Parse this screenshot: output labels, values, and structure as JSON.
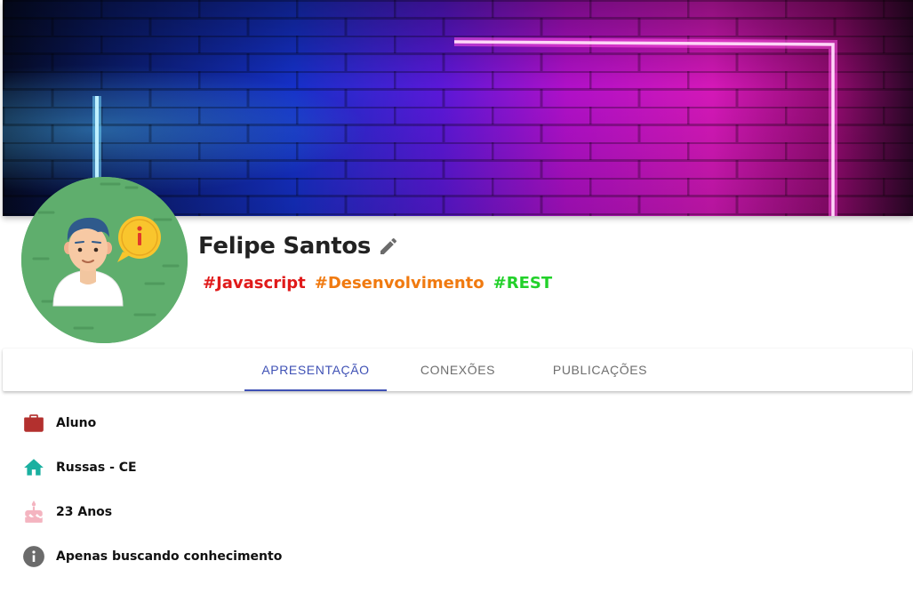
{
  "profile": {
    "name": "Felipe Santos"
  },
  "tags": [
    {
      "label": "#Javascript",
      "color": "#e01a1a"
    },
    {
      "label": "#Desenvolvimento",
      "color": "#f07a10"
    },
    {
      "label": "#REST",
      "color": "#22d12a"
    }
  ],
  "tabs": [
    {
      "label": "APRESENTAÇÃO",
      "active": true
    },
    {
      "label": "CONEXÕES",
      "active": false
    },
    {
      "label": "PUBLICAÇÕES",
      "active": false
    }
  ],
  "info": [
    {
      "icon": "briefcase-icon",
      "text": "Aluno",
      "color": "#b3302e"
    },
    {
      "icon": "home-icon",
      "text": "Russas - CE",
      "color": "#1ab0a0"
    },
    {
      "icon": "cake-icon",
      "text": "23 Anos",
      "color": "#f4b4c0"
    },
    {
      "icon": "info-icon",
      "text": "Apenas buscando conhecimento",
      "color": "#6b6b6b"
    }
  ],
  "colors": {
    "accent": "#3f51b5",
    "avatar_bg": "#5fae6d"
  }
}
